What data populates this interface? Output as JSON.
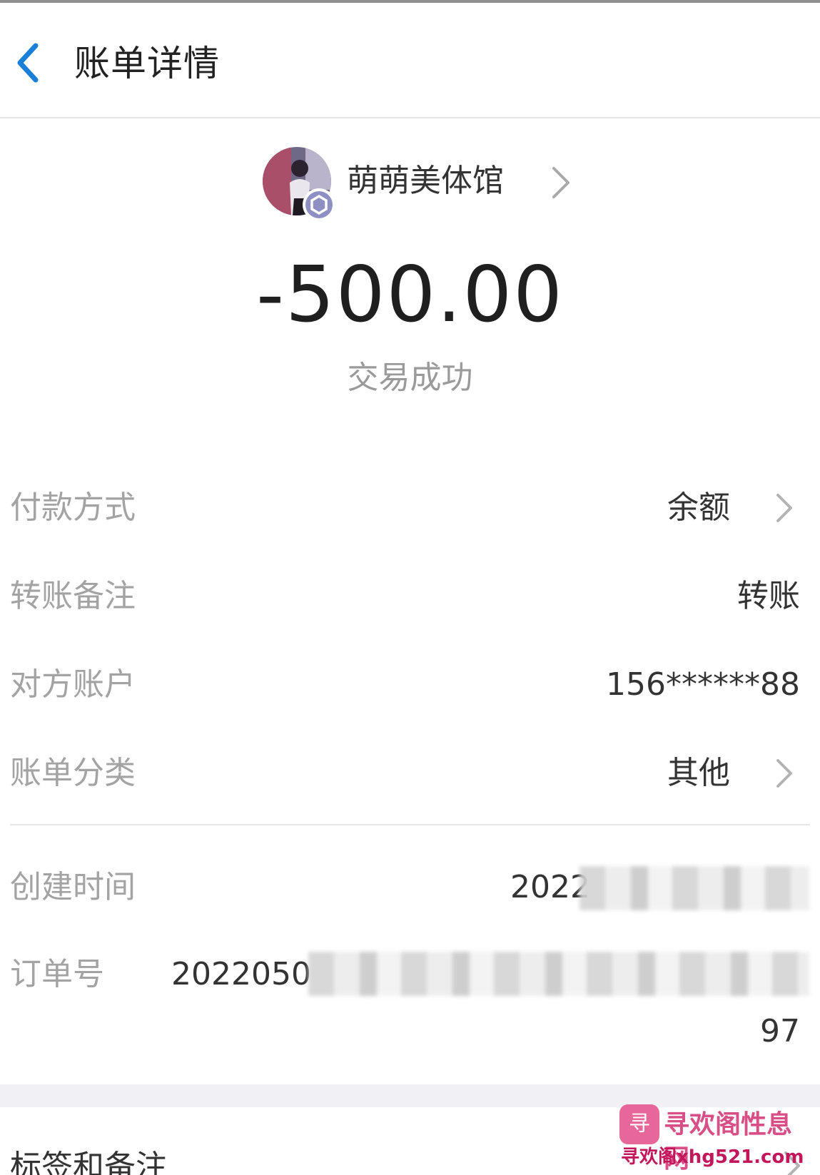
{
  "header": {
    "title": "账单详情",
    "back_icon": "chevron-left-icon",
    "accent_color": "#1a7fd8"
  },
  "payee": {
    "name": "萌萌美体馆",
    "avatar_icon": "avatar",
    "badge_icon": "verified-hexagon-icon",
    "arrow_icon": "chevron-right-icon"
  },
  "transaction": {
    "amount": "-500.00",
    "status": "交易成功"
  },
  "details": {
    "payment_method": {
      "label": "付款方式",
      "value": "余额"
    },
    "transfer_note": {
      "label": "转账备注",
      "value": "转账"
    },
    "counterparty_account": {
      "label": "对方账户",
      "value": "156******88"
    },
    "bill_category": {
      "label": "账单分类",
      "value": "其他"
    },
    "created_time": {
      "label": "创建时间",
      "value_visible": "2022"
    },
    "order_number": {
      "label": "订单号",
      "value_visible_start": "2022050",
      "value_visible_end": "97"
    }
  },
  "tags_section": {
    "label": "标签和备注",
    "action_arrow_icon": "chevron-right-icon"
  },
  "watermark": {
    "logo_glyph": "寻",
    "title": "寻欢阁性息网",
    "url": "寻欢阁xhg521.com"
  }
}
